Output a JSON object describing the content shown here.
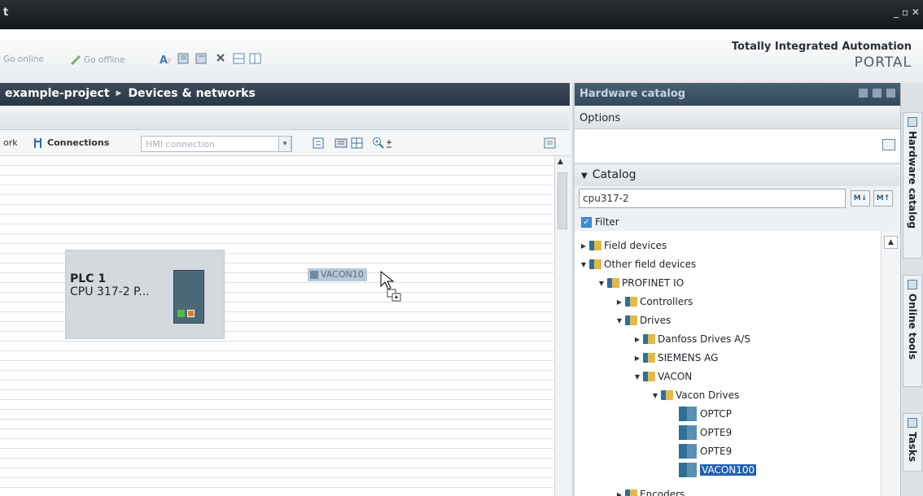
{
  "window": {
    "title": "t",
    "controls": "_ ▫ ✕"
  },
  "toolbar": {
    "go_online": "Go online",
    "go_offline": "Go offline",
    "brand_line1": "Totally Integrated Automation",
    "brand_line2": "PORTAL"
  },
  "breadcrumb": {
    "project": "example-project",
    "section": "Devices & networks"
  },
  "editor": {
    "network_label": "ork",
    "connections_label": "Connections",
    "hmi_connection": "HMI connection"
  },
  "canvas": {
    "plc_name": "PLC 1",
    "plc_cpu": "CPU 317-2 P...",
    "drag_label": "VACON10"
  },
  "hardware_catalog": {
    "title": "Hardware catalog",
    "options": "Options",
    "catalog": "Catalog",
    "search_value": "cpu317-2",
    "filter": "Filter",
    "tree": [
      {
        "label": "Field devices"
      },
      {
        "label": "Other field devices"
      },
      {
        "label": "PROFINET IO"
      },
      {
        "label": "Controllers"
      },
      {
        "label": "Drives"
      },
      {
        "label": "Danfoss Drives A/S"
      },
      {
        "label": "SIEMENS AG"
      },
      {
        "label": "VACON"
      },
      {
        "label": "Vacon Drives"
      },
      {
        "label": "OPTCP"
      },
      {
        "label": "OPTE9"
      },
      {
        "label": "OPTE9"
      },
      {
        "label": "VACON100"
      },
      {
        "label": "Encoders"
      }
    ]
  },
  "side_tabs": [
    "Hardware catalog",
    "Online tools",
    "Tasks"
  ]
}
